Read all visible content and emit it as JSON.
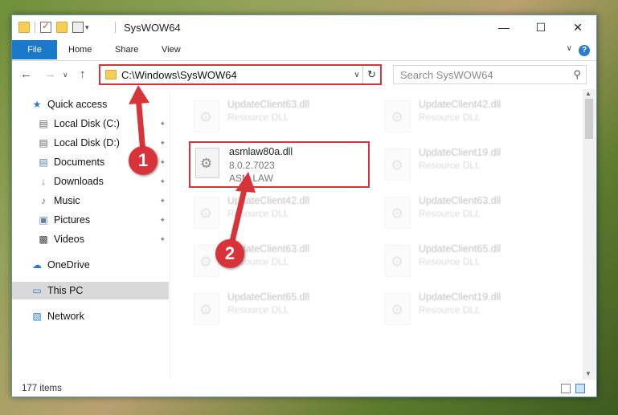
{
  "window": {
    "title": "SysWOW64"
  },
  "ribbon": {
    "tabs": [
      "File",
      "Home",
      "Share",
      "View"
    ]
  },
  "nav": {
    "address": "C:\\Windows\\SysWOW64",
    "search_placeholder": "Search SysWOW64"
  },
  "sidebar": {
    "items": [
      {
        "label": "Quick access",
        "icon": "star-icon"
      },
      {
        "label": "Local Disk (C:)",
        "icon": "drive-icon"
      },
      {
        "label": "Local Disk (D:)",
        "icon": "drive-icon"
      },
      {
        "label": "Documents",
        "icon": "documents-icon"
      },
      {
        "label": "Downloads",
        "icon": "download-icon"
      },
      {
        "label": "Music",
        "icon": "music-icon"
      },
      {
        "label": "Pictures",
        "icon": "pictures-icon"
      },
      {
        "label": "Videos",
        "icon": "videos-icon"
      },
      {
        "label": "OneDrive",
        "icon": "cloud-icon"
      },
      {
        "label": "This PC",
        "icon": "computer-icon"
      },
      {
        "label": "Network",
        "icon": "network-icon"
      }
    ]
  },
  "files": {
    "left": [
      {
        "name": "UpdateClient63.dll",
        "type": "Resource DLL"
      },
      {
        "name": "asmlaw80a.dll",
        "version": "8.0.2.7023",
        "company": "ASM LAW"
      },
      {
        "name": "UpdateClient42.dll",
        "type": "Resource DLL"
      },
      {
        "name": "UpdateClient63.dll",
        "type": "Resource DLL"
      },
      {
        "name": "UpdateClient65.dll",
        "type": "Resource DLL"
      }
    ],
    "right": [
      {
        "name": "UpdateClient42.dll",
        "type": "Resource DLL"
      },
      {
        "name": "UpdateClient19.dll",
        "type": "Resource DLL"
      },
      {
        "name": "UpdateClient63.dll",
        "type": "Resource DLL"
      },
      {
        "name": "UpdateClient65.dll",
        "type": "Resource DLL"
      },
      {
        "name": "UpdateClient19.dll",
        "type": "Resource DLL"
      }
    ]
  },
  "status": {
    "count": "177 items"
  },
  "annotations": {
    "marker1": "1",
    "marker2": "2"
  },
  "colors": {
    "accent": "#1979ca",
    "highlight": "#d9333a"
  }
}
